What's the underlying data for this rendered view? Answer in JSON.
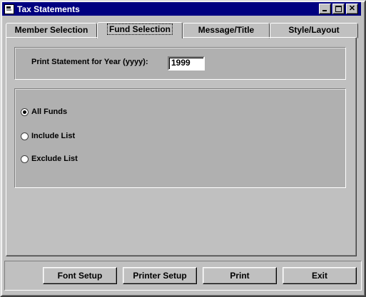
{
  "window": {
    "title": "Tax Statements",
    "controls": {
      "minimize": "minimize-icon",
      "maximize": "maximize-icon",
      "close": "✕"
    }
  },
  "tabs": [
    {
      "label": "Member Selection",
      "active": false
    },
    {
      "label": "Fund Selection",
      "active": true
    },
    {
      "label": "Message/Title",
      "active": false
    },
    {
      "label": "Style/Layout",
      "active": false
    }
  ],
  "year": {
    "label": "Print Statement for Year (yyyy):",
    "value": "1999"
  },
  "funds": {
    "options": [
      {
        "label": "All Funds",
        "selected": true
      },
      {
        "label": "Include List",
        "selected": false
      },
      {
        "label": "Exclude List",
        "selected": false
      }
    ]
  },
  "buttons": {
    "font_setup": "Font Setup",
    "printer_setup": "Printer Setup",
    "print": "Print",
    "exit": "Exit"
  }
}
